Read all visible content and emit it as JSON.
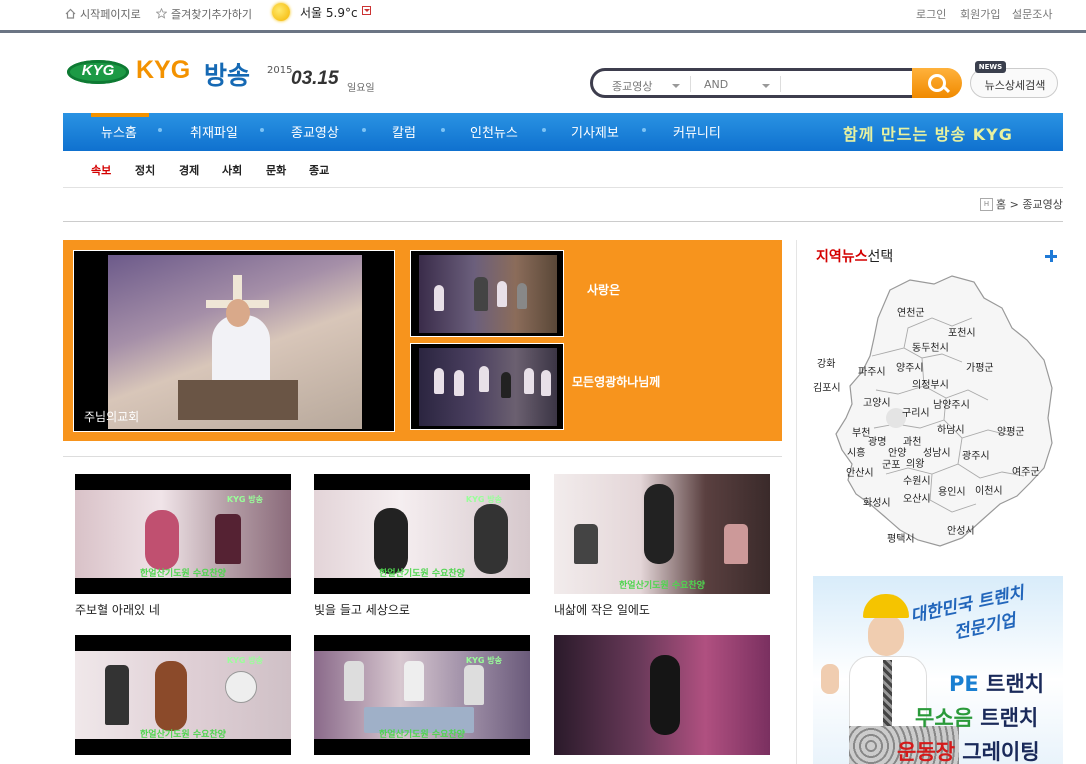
{
  "topbar": {
    "start_page": "시작페이지로",
    "favorites": "즐겨찾기추가하기",
    "weather": "서울 5.9°c",
    "login": "로그인",
    "signup": "회원가입",
    "survey": "설문조사"
  },
  "logo": {
    "mark": "KYG",
    "name_en": "KYG",
    "name_ko": "방송"
  },
  "date": {
    "year": "2015",
    "month_day": "03.15",
    "weekday": "일요일"
  },
  "search": {
    "category": "종교영상",
    "operator": "AND",
    "input_value": "",
    "news_badge": "NEWS",
    "detail_search": "뉴스상세검색"
  },
  "gnb": {
    "items": [
      "뉴스홈",
      "취재파일",
      "종교영상",
      "칼럼",
      "인천뉴스",
      "기사제보",
      "커뮤니티"
    ],
    "slogan": "함께 만드는 방송 KYG"
  },
  "submenu": {
    "items": [
      "속보",
      "정치",
      "경제",
      "사회",
      "문화",
      "종교"
    ],
    "active_color": "#d40000"
  },
  "breadcrumb": {
    "home_icon_label": "H",
    "text": "홈 > 종교영상"
  },
  "featured": {
    "main_caption": "주님의교회",
    "side_titles": [
      "사랑은",
      "모든영광하나님께"
    ],
    "bg_color": "#f7941d"
  },
  "videos": [
    {
      "title": "주보혈 아래있 네",
      "subtitle": "한얼산기도원 수요찬양",
      "logo": "KYG 방송"
    },
    {
      "title": "빛을 들고 세상으로",
      "subtitle": "한얼산기도원 수요찬양",
      "logo": "KYG 방송"
    },
    {
      "title": "내삶에 작은 일에도",
      "subtitle": "한얼산기도원 수요찬양",
      "logo": ""
    },
    {
      "title": "",
      "subtitle": "한얼산기도원 수요찬양",
      "logo": "KYG 방송"
    },
    {
      "title": "",
      "subtitle": "한얼산기도원 수요찬양",
      "logo": "KYG 방송"
    },
    {
      "title": "",
      "subtitle": "",
      "logo": ""
    }
  ],
  "region": {
    "title_red": "지역뉴스",
    "title_rest": "선택",
    "cities": [
      "연천군",
      "포천시",
      "동두천시",
      "파주시",
      "양주시",
      "가평군",
      "강화",
      "김포시",
      "의정부시",
      "고양시",
      "남양주시",
      "구리시",
      "부천",
      "광명",
      "과천",
      "하남시",
      "양평군",
      "시흥",
      "안양",
      "군포",
      "의왕",
      "성남시",
      "광주시",
      "안산시",
      "수원시",
      "여주군",
      "화성시",
      "오산시",
      "용인시",
      "이천시",
      "안성시",
      "평택시"
    ]
  },
  "ad": {
    "headline1": "대한민국 트렌치",
    "headline2": "전문기업",
    "line1_a": "PE",
    "line1_b": " 트랜치",
    "line2_a": "무소음",
    "line2_b": " 트랜치",
    "line3_a": "운동장",
    "line3_b": " 그레이팅"
  },
  "colors": {
    "gnb_blue": "#1a80d9",
    "accent_orange": "#f39200",
    "brand_green": "#1d9a45"
  }
}
